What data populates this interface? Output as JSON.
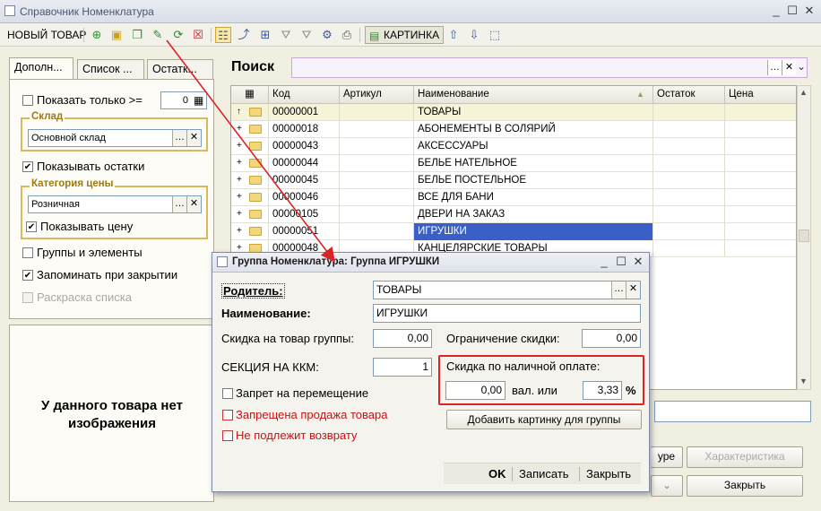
{
  "window": {
    "title": "Справочник Номенклатура"
  },
  "toolbar": {
    "new_item": "НОВЫЙ ТОВАР",
    "picture": "КАРТИНКА"
  },
  "left": {
    "tabs": [
      "Дополн...",
      "Список ...",
      "Остатк..."
    ],
    "show_only_label": "Показать только >=",
    "show_only_value": "0",
    "warehouse_title": "Склад",
    "warehouse_value": "Основной склад",
    "show_balance": "Показывать остатки",
    "price_category_title": "Категория цены",
    "price_category_value": "Розничная",
    "show_price": "Показывать цену",
    "groups_and_elements": "Группы и элементы",
    "remember_on_close": "Запоминать при закрытии",
    "list_coloring": "Раскраска списка",
    "no_image": "У данного товара нет изображения"
  },
  "search": {
    "label": "Поиск"
  },
  "grid": {
    "columns": [
      "Код",
      "Артикул",
      "Наименование",
      "Остаток",
      "Цена"
    ],
    "rows": [
      {
        "code": "00000001",
        "name": "ТОВАРЫ"
      },
      {
        "code": "00000018",
        "name": "АБОНЕМЕНТЫ В СОЛЯРИЙ"
      },
      {
        "code": "00000043",
        "name": "АКСЕССУАРЫ"
      },
      {
        "code": "00000044",
        "name": "БЕЛЬЕ НАТЕЛЬНОЕ"
      },
      {
        "code": "00000045",
        "name": "БЕЛЬЕ ПОСТЕЛЬНОЕ"
      },
      {
        "code": "00000046",
        "name": "ВСЕ ДЛЯ БАНИ"
      },
      {
        "code": "00000105",
        "name": "ДВЕРИ НА ЗАКАЗ"
      },
      {
        "code": "00000051",
        "name": "ИГРУШКИ"
      },
      {
        "code": "00000048",
        "name": "КАНЦЕЛЯРСКИЕ ТОВАРЫ"
      }
    ]
  },
  "bottom": {
    "characteristic": "Характеристика",
    "close": "Закрыть",
    "partial": "уре"
  },
  "dialog": {
    "title": "Группа Номенклатура: Группа ИГРУШКИ",
    "parent_label": "Родитель:",
    "parent_value": "ТОВАРЫ",
    "name_label": "Наименование:",
    "name_value": "ИГРУШКИ",
    "group_discount_label": "Скидка на товар группы:",
    "group_discount_value": "0,00",
    "discount_limit_label": "Ограничение скидки:",
    "discount_limit_value": "0,00",
    "kkm_label": "СЕКЦИЯ НА ККМ:",
    "kkm_value": "1",
    "cash_discount_label": "Скидка по наличной оплате:",
    "cash_value": "0,00",
    "currency_or": "вал. или",
    "percent_value": "3,33",
    "percent_sign": "%",
    "no_move": "Запрет на перемещение",
    "no_sale": "Запрещена продажа товара",
    "no_return": "Не подлежит возврату",
    "add_picture": "Добавить картинку для группы",
    "ok": "OK",
    "save": "Записать",
    "close": "Закрыть"
  },
  "colors": {
    "selected_row": "#3a60c8",
    "red_text": "#cc1111",
    "highlight_box": "#dd2222"
  }
}
